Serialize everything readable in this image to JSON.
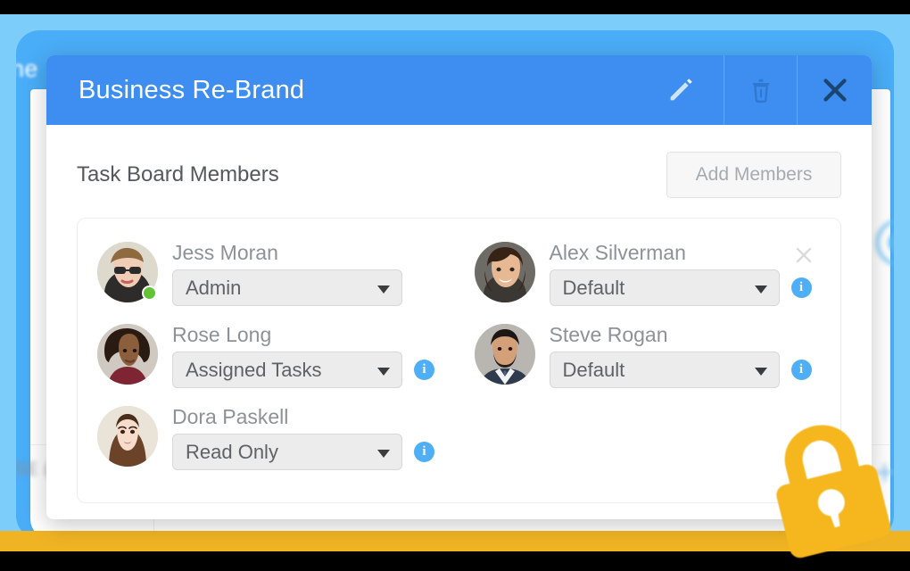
{
  "background": {
    "app_title_fragment": "ne",
    "bottom_left_text_fragment": "SE (",
    "plus_icon": "plus-icon",
    "colors": {
      "backdrop_blue": "#7dcdfb",
      "card_blue": "#4aadf7",
      "bottom_bar_yellow": "#f0b323"
    }
  },
  "modal": {
    "title": "Business Re-Brand",
    "header_actions": [
      {
        "name": "edit-button",
        "icon": "pencil-icon",
        "label": "Edit"
      },
      {
        "name": "delete-button",
        "icon": "trash-icon",
        "label": "Delete"
      },
      {
        "name": "close-button",
        "icon": "close-icon",
        "label": "Close"
      }
    ],
    "header_color": "#3d8ef0",
    "section": {
      "title": "Task Board Members",
      "add_members_label": "Add Members"
    },
    "members": [
      {
        "name": "Jess Moran",
        "role": "Admin",
        "online": true,
        "has_info": false,
        "has_remove": false,
        "avatar": "avatar-jess-moran",
        "status_color": "#62c334"
      },
      {
        "name": "Alex Silverman",
        "role": "Default",
        "online": false,
        "has_info": true,
        "has_remove": true,
        "avatar": "avatar-alex-silverman",
        "status_color": ""
      },
      {
        "name": "Rose Long",
        "role": "Assigned Tasks",
        "online": false,
        "has_info": true,
        "has_remove": false,
        "avatar": "avatar-rose-long",
        "status_color": ""
      },
      {
        "name": "Steve Rogan",
        "role": "Default",
        "online": false,
        "has_info": true,
        "has_remove": false,
        "avatar": "avatar-steve-rogan",
        "status_color": ""
      },
      {
        "name": "Dora Paskell",
        "role": "Read Only",
        "online": false,
        "has_info": true,
        "has_remove": false,
        "avatar": "avatar-dora-paskell",
        "status_color": ""
      }
    ]
  },
  "overlay": {
    "lock_icon": "lock-icon",
    "lock_color": "#f5b71d"
  }
}
